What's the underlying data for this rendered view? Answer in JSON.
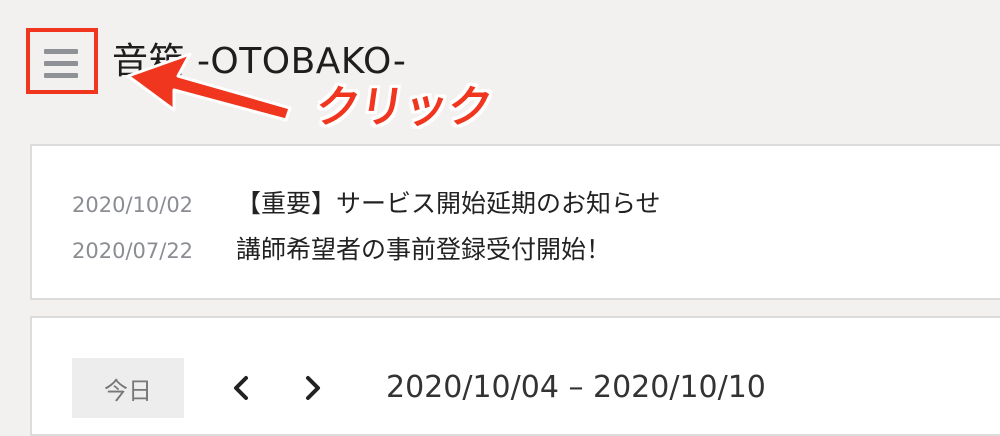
{
  "header": {
    "menu_icon": "hamburger-menu-icon",
    "site_title": "音箱 -OTOBAKO-"
  },
  "annotation": {
    "label": "クリック",
    "color": "#f0361e"
  },
  "news": [
    {
      "date": "2020/10/02",
      "text": "【重要】サービス開始延期のお知らせ"
    },
    {
      "date": "2020/07/22",
      "text": "講師希望者の事前登録受付開始！"
    }
  ],
  "calendar": {
    "today_label": "今日",
    "prev_icon": "chevron-left-icon",
    "next_icon": "chevron-right-icon",
    "date_range": "2020/10/04 – 2020/10/10"
  }
}
